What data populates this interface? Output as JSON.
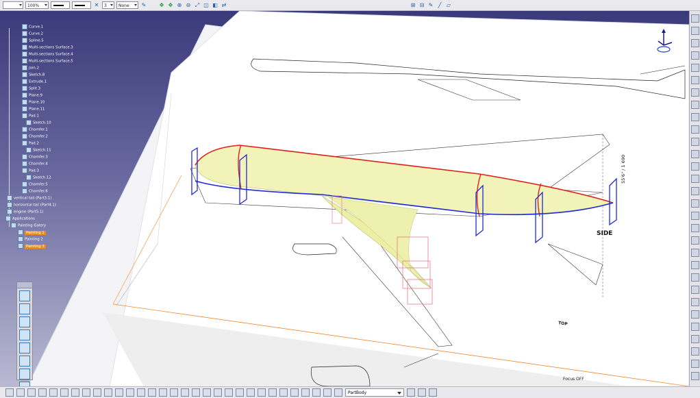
{
  "toolbar": {
    "line_width": "",
    "zoom": "100%",
    "layer_count": "3",
    "layer": "None"
  },
  "tree": [
    {
      "label": "Curve.1"
    },
    {
      "label": "Curve.2"
    },
    {
      "label": "Spline.5"
    },
    {
      "label": "Multi-sections Surface.3"
    },
    {
      "label": "Multi-sections Surface.4"
    },
    {
      "label": "Multi-sections Surface.5"
    },
    {
      "label": "Join.2"
    },
    {
      "label": "Sketch.8"
    },
    {
      "label": "Extrude.1"
    },
    {
      "label": "Split.3"
    },
    {
      "label": "Plane.9"
    },
    {
      "label": "Plane.10"
    },
    {
      "label": "Plane.11"
    },
    {
      "label": "Pad.1"
    },
    {
      "label": "Sketch.10"
    },
    {
      "label": "Chamfer.1"
    },
    {
      "label": "Chamfer.2"
    },
    {
      "label": "Pad.2"
    },
    {
      "label": "Sketch.11"
    },
    {
      "label": "Chamfer.3"
    },
    {
      "label": "Chamfer.4"
    },
    {
      "label": "Pad.3"
    },
    {
      "label": "Sketch.12"
    },
    {
      "label": "Chamfer.5"
    },
    {
      "label": "Chamfer.6"
    },
    {
      "label": "vertical tail (Part3.1)"
    },
    {
      "label": "horizontal tail (Part4.1)"
    },
    {
      "label": "engine (Part5.1)"
    },
    {
      "label": "Applications"
    },
    {
      "label": "Painting Galery"
    },
    {
      "label": "Painting 1"
    },
    {
      "label": "Painting 2"
    },
    {
      "label": "Painting 3"
    }
  ],
  "drawing": {
    "side_label": "SIDE",
    "top_label": "TOP",
    "dimension": "55'6\" / 1 690"
  },
  "status": {
    "focus": "Focus OFF"
  },
  "bottombar": {
    "body_select": "PartBody"
  },
  "colors": {
    "background_top": "#3a3a7a",
    "fuselage": "#f1f3b8",
    "red_curve": "#e0201a",
    "blue_curve": "#1f2ad8",
    "highlight": "#f28a12"
  }
}
